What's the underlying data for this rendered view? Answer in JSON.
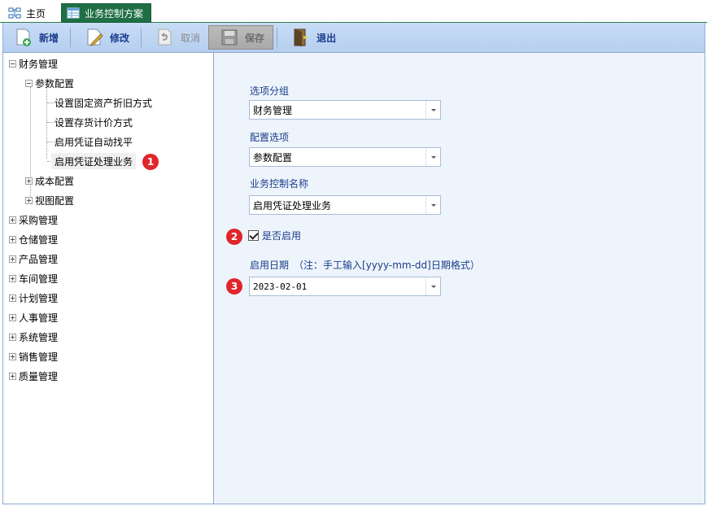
{
  "tabs": {
    "home": "主页",
    "active": "业务控制方案"
  },
  "toolbar": {
    "new": "新增",
    "edit": "修改",
    "cancel": "取消",
    "save": "保存",
    "exit": "退出"
  },
  "tree": {
    "finance": "财务管理",
    "params": "参数配置",
    "leaf1": "设置固定资产折旧方式",
    "leaf2": "设置存货计价方式",
    "leaf3": "启用凭证自动找平",
    "leaf4": "启用凭证处理业务",
    "cost": "成本配置",
    "view": "视图配置",
    "purchase": "采购管理",
    "warehouse": "仓储管理",
    "product": "产品管理",
    "workshop": "车间管理",
    "plan": "计划管理",
    "hr": "人事管理",
    "system": "系统管理",
    "sales": "销售管理",
    "quality": "质量管理"
  },
  "badges": {
    "b1": "1",
    "b2": "2",
    "b3": "3"
  },
  "form": {
    "group_label": "选项分组",
    "group_value": "财务管理",
    "config_label": "配置选项",
    "config_value": "参数配置",
    "name_label": "业务控制名称",
    "name_value": "启用凭证处理业务",
    "enable_label": "是否启用",
    "enable_checked": true,
    "date_label": "启用日期　（注：手工输入[yyyy-mm-dd]日期格式）",
    "date_value": "2023-02-01"
  },
  "colors": {
    "tab_active": "#1f6e45",
    "toolbar": "#c8dcf5",
    "form_bg": "#eef4fb",
    "label": "#1a3c8c",
    "badge": "#e0262b"
  }
}
